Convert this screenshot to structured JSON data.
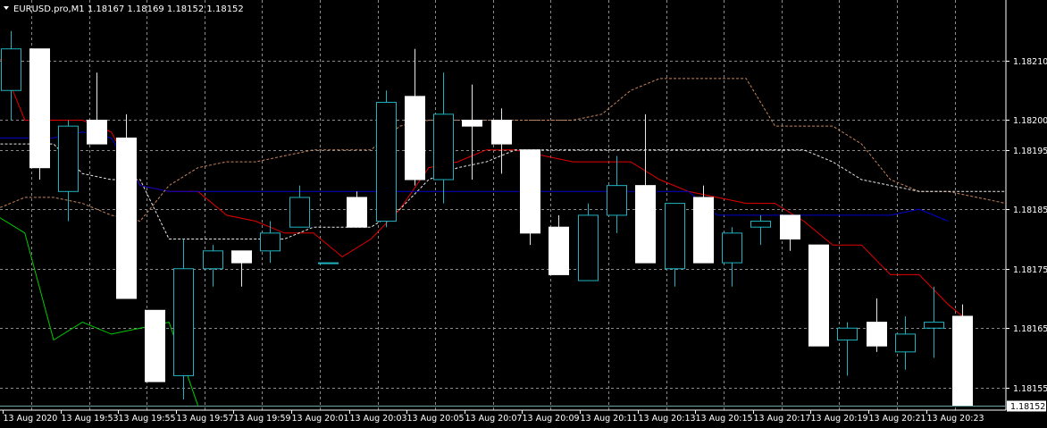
{
  "chart": {
    "title": "EURUSD.pro,M1  1.18167 1.18169 1.18152 1.18152",
    "current_price_label": "1.18152"
  },
  "chart_data": {
    "type": "candlestick",
    "symbol": "EURUSD.pro",
    "timeframe": "M1",
    "ylim": [
      1.18147,
      1.18218
    ],
    "y_ticks": [
      {
        "value": 1.1821,
        "label": "1.18210"
      },
      {
        "value": 1.182,
        "label": "1.18200"
      },
      {
        "value": 1.18195,
        "label": "1.18195"
      },
      {
        "value": 1.18185,
        "label": "1.18185"
      },
      {
        "value": 1.18175,
        "label": "1.18175"
      },
      {
        "value": 1.18165,
        "label": "1.18165"
      },
      {
        "value": 1.18155,
        "label": "1.18155"
      }
    ],
    "x_ticks": [
      {
        "index": 0,
        "label": "13 Aug 2020"
      },
      {
        "index": 2,
        "label": "13 Aug 19:53"
      },
      {
        "index": 4,
        "label": "13 Aug 19:55"
      },
      {
        "index": 6,
        "label": "13 Aug 19:57"
      },
      {
        "index": 8,
        "label": "13 Aug 19:59"
      },
      {
        "index": 10,
        "label": "13 Aug 20:01"
      },
      {
        "index": 12,
        "label": "13 Aug 20:03"
      },
      {
        "index": 14,
        "label": "13 Aug 20:05"
      },
      {
        "index": 16,
        "label": "13 Aug 20:07"
      },
      {
        "index": 18,
        "label": "13 Aug 20:09"
      },
      {
        "index": 20,
        "label": "13 Aug 20:11"
      },
      {
        "index": 22,
        "label": "13 Aug 20:13"
      },
      {
        "index": 24,
        "label": "13 Aug 20:15"
      },
      {
        "index": 26,
        "label": "13 Aug 20:17"
      },
      {
        "index": 28,
        "label": "13 Aug 20:19"
      },
      {
        "index": 30,
        "label": "13 Aug 20:21"
      },
      {
        "index": 32,
        "label": "13 Aug 20:23"
      }
    ],
    "current_price": 1.18152,
    "candles": [
      {
        "open": 1.18205,
        "high": 1.18215,
        "low": 1.182,
        "close": 1.18212
      },
      {
        "open": 1.18212,
        "high": 1.18212,
        "low": 1.1819,
        "close": 1.18192
      },
      {
        "open": 1.18188,
        "high": 1.182,
        "low": 1.18183,
        "close": 1.18199
      },
      {
        "open": 1.182,
        "high": 1.18208,
        "low": 1.18196,
        "close": 1.18196
      },
      {
        "open": 1.18197,
        "high": 1.18201,
        "low": 1.1817,
        "close": 1.1817
      },
      {
        "open": 1.18168,
        "high": 1.18168,
        "low": 1.18156,
        "close": 1.18156
      },
      {
        "open": 1.18157,
        "high": 1.1818,
        "low": 1.18153,
        "close": 1.18175
      },
      {
        "open": 1.18175,
        "high": 1.18179,
        "low": 1.18172,
        "close": 1.18178
      },
      {
        "open": 1.18178,
        "high": 1.18178,
        "low": 1.18172,
        "close": 1.18176
      },
      {
        "open": 1.18178,
        "high": 1.18183,
        "low": 1.18176,
        "close": 1.18181
      },
      {
        "open": 1.18182,
        "high": 1.18189,
        "low": 1.18182,
        "close": 1.18187
      },
      {
        "open": 1.18176,
        "high": 1.18176,
        "low": 1.18176,
        "close": 1.18176
      },
      {
        "open": 1.18187,
        "high": 1.18188,
        "low": 1.18182,
        "close": 1.18182
      },
      {
        "open": 1.18183,
        "high": 1.18205,
        "low": 1.18182,
        "close": 1.18203
      },
      {
        "open": 1.18204,
        "high": 1.18212,
        "low": 1.18189,
        "close": 1.1819
      },
      {
        "open": 1.1819,
        "high": 1.18208,
        "low": 1.18186,
        "close": 1.18201
      },
      {
        "open": 1.182,
        "high": 1.18206,
        "low": 1.1819,
        "close": 1.18199
      },
      {
        "open": 1.182,
        "high": 1.18202,
        "low": 1.18191,
        "close": 1.18196
      },
      {
        "open": 1.18195,
        "high": 1.18195,
        "low": 1.18179,
        "close": 1.18181
      },
      {
        "open": 1.18182,
        "high": 1.18184,
        "low": 1.18174,
        "close": 1.18174
      },
      {
        "open": 1.18173,
        "high": 1.18186,
        "low": 1.18173,
        "close": 1.18184
      },
      {
        "open": 1.18184,
        "high": 1.18194,
        "low": 1.18181,
        "close": 1.18189
      },
      {
        "open": 1.18189,
        "high": 1.18201,
        "low": 1.18176,
        "close": 1.18176
      },
      {
        "open": 1.18175,
        "high": 1.18186,
        "low": 1.18172,
        "close": 1.18186
      },
      {
        "open": 1.18187,
        "high": 1.18189,
        "low": 1.18176,
        "close": 1.18176
      },
      {
        "open": 1.18176,
        "high": 1.18182,
        "low": 1.18172,
        "close": 1.18181
      },
      {
        "open": 1.18182,
        "high": 1.18184,
        "low": 1.18179,
        "close": 1.18183
      },
      {
        "open": 1.18184,
        "high": 1.18184,
        "low": 1.18178,
        "close": 1.1818
      },
      {
        "open": 1.18179,
        "high": 1.18179,
        "low": 1.18162,
        "close": 1.18162
      },
      {
        "open": 1.18163,
        "high": 1.18166,
        "low": 1.18157,
        "close": 1.18165
      },
      {
        "open": 1.18166,
        "high": 1.1817,
        "low": 1.18161,
        "close": 1.18162
      },
      {
        "open": 1.18161,
        "high": 1.18167,
        "low": 1.18158,
        "close": 1.18164
      },
      {
        "open": 1.18165,
        "high": 1.18172,
        "low": 1.1816,
        "close": 1.18166
      },
      {
        "open": 1.18167,
        "high": 1.18169,
        "low": 1.18152,
        "close": 1.18152
      }
    ],
    "indicators": [
      {
        "kind": "tenkan",
        "color": "#e60000",
        "dash": "",
        "points": [
          [
            -0.5,
            1.18212
          ],
          [
            0.5,
            1.182
          ],
          [
            1.5,
            1.182
          ],
          [
            2.5,
            1.182
          ],
          [
            3.5,
            1.18198
          ],
          [
            4.5,
            1.18189
          ],
          [
            5.5,
            1.18188
          ],
          [
            6.5,
            1.18188
          ],
          [
            7.5,
            1.18184
          ],
          [
            8.5,
            1.18183
          ],
          [
            9.5,
            1.18181
          ],
          [
            10.5,
            1.18181
          ],
          [
            11.5,
            1.18177
          ],
          [
            12.5,
            1.1818
          ],
          [
            13.5,
            1.18185
          ],
          [
            14.5,
            1.18192
          ],
          [
            15.5,
            1.18193
          ],
          [
            16.5,
            1.18195
          ],
          [
            17.5,
            1.18195
          ],
          [
            18.5,
            1.18194
          ],
          [
            19.5,
            1.18193
          ],
          [
            20.5,
            1.18193
          ],
          [
            21.5,
            1.18193
          ],
          [
            22.5,
            1.1819
          ],
          [
            23.5,
            1.18188
          ],
          [
            24.5,
            1.18187
          ],
          [
            25.5,
            1.18186
          ],
          [
            26.5,
            1.18186
          ],
          [
            27.5,
            1.18183
          ],
          [
            28.5,
            1.18179
          ],
          [
            29.5,
            1.18179
          ],
          [
            30.5,
            1.18174
          ],
          [
            31.5,
            1.18174
          ],
          [
            32.5,
            1.18169
          ],
          [
            33,
            1.18167
          ]
        ]
      },
      {
        "kind": "kijun",
        "color": "#0000cc",
        "dash": "",
        "points": [
          [
            -0.5,
            1.18197
          ],
          [
            0.5,
            1.18197
          ],
          [
            1.5,
            1.18197
          ],
          [
            2.5,
            1.18198
          ],
          [
            3.5,
            1.18197
          ],
          [
            4.5,
            1.18189
          ],
          [
            5.5,
            1.18188
          ],
          [
            6.5,
            1.18188
          ],
          [
            7.5,
            1.18188
          ],
          [
            8.5,
            1.18188
          ],
          [
            9.5,
            1.18188
          ],
          [
            10.5,
            1.18188
          ],
          [
            11.5,
            1.18188
          ],
          [
            12.5,
            1.18188
          ],
          [
            13.5,
            1.18188
          ],
          [
            14.5,
            1.18188
          ],
          [
            15.5,
            1.18188
          ],
          [
            16.5,
            1.18188
          ],
          [
            17.5,
            1.18188
          ],
          [
            18.5,
            1.18188
          ],
          [
            19.5,
            1.18188
          ],
          [
            20.5,
            1.18188
          ],
          [
            21.5,
            1.18188
          ],
          [
            22.5,
            1.18188
          ],
          [
            23.5,
            1.18188
          ],
          [
            24.5,
            1.18184
          ],
          [
            25.5,
            1.18184
          ],
          [
            26.5,
            1.18184
          ],
          [
            27.5,
            1.18184
          ],
          [
            28.5,
            1.18184
          ],
          [
            29.5,
            1.18184
          ],
          [
            30.5,
            1.18184
          ],
          [
            31.5,
            1.18185
          ],
          [
            32.5,
            1.18183
          ]
        ]
      },
      {
        "kind": "chikou",
        "color": "#00cc00",
        "dash": "",
        "points": [
          [
            -0.5,
            1.18184
          ],
          [
            0.5,
            1.18181
          ],
          [
            1.5,
            1.18163
          ],
          [
            2.5,
            1.18166
          ],
          [
            3.5,
            1.18164
          ],
          [
            4.5,
            1.18165
          ],
          [
            5.5,
            1.18166
          ],
          [
            6.5,
            1.18152
          ]
        ]
      },
      {
        "kind": "senkou-a",
        "color": "#c8855a",
        "dash": "3,2",
        "points": [
          [
            -0.5,
            1.18185
          ],
          [
            0.5,
            1.18187
          ],
          [
            1.5,
            1.18187
          ],
          [
            2.5,
            1.18186
          ],
          [
            3.5,
            1.18184
          ],
          [
            4.5,
            1.18183
          ],
          [
            5.5,
            1.18189
          ],
          [
            6.5,
            1.18192
          ],
          [
            7.5,
            1.18193
          ],
          [
            8.5,
            1.18193
          ],
          [
            9.5,
            1.18194
          ],
          [
            10.5,
            1.18195
          ],
          [
            11.5,
            1.18195
          ],
          [
            12.5,
            1.18195
          ],
          [
            13.5,
            1.18199
          ],
          [
            14.5,
            1.182
          ],
          [
            15.5,
            1.182
          ],
          [
            16.5,
            1.182
          ],
          [
            17.5,
            1.182
          ],
          [
            18.5,
            1.182
          ],
          [
            19.5,
            1.182
          ],
          [
            20.5,
            1.18201
          ],
          [
            21.5,
            1.18205
          ],
          [
            22.5,
            1.18207
          ],
          [
            23.5,
            1.18207
          ],
          [
            24.5,
            1.18207
          ],
          [
            25.5,
            1.18207
          ],
          [
            26.5,
            1.18199
          ],
          [
            27.5,
            1.18199
          ],
          [
            28.5,
            1.18199
          ],
          [
            29.5,
            1.18196
          ],
          [
            30.5,
            1.1819
          ],
          [
            31.5,
            1.18188
          ],
          [
            32.5,
            1.18188
          ],
          [
            33.5,
            1.18187
          ],
          [
            34.5,
            1.18186
          ]
        ]
      },
      {
        "kind": "senkou-b",
        "color": "#e8e8e8",
        "dash": "3,2",
        "points": [
          [
            -0.5,
            1.18196
          ],
          [
            0.5,
            1.18196
          ],
          [
            1.5,
            1.18196
          ],
          [
            2.5,
            1.18191
          ],
          [
            3.5,
            1.1819
          ],
          [
            4.5,
            1.1819
          ],
          [
            5.5,
            1.1818
          ],
          [
            6.5,
            1.1818
          ],
          [
            7.5,
            1.1818
          ],
          [
            8.5,
            1.1818
          ],
          [
            9.5,
            1.1818
          ],
          [
            10.5,
            1.18182
          ],
          [
            11.5,
            1.18182
          ],
          [
            12.5,
            1.18182
          ],
          [
            13.5,
            1.18185
          ],
          [
            14.5,
            1.1819
          ],
          [
            15.5,
            1.18192
          ],
          [
            16.5,
            1.18193
          ],
          [
            17.5,
            1.18195
          ],
          [
            18.5,
            1.18195
          ],
          [
            19.5,
            1.18195
          ],
          [
            20.5,
            1.18195
          ],
          [
            21.5,
            1.18195
          ],
          [
            22.5,
            1.18195
          ],
          [
            23.5,
            1.18195
          ],
          [
            24.5,
            1.18195
          ],
          [
            25.5,
            1.18195
          ],
          [
            26.5,
            1.18195
          ],
          [
            27.5,
            1.18195
          ],
          [
            28.5,
            1.18193
          ],
          [
            29.5,
            1.1819
          ],
          [
            30.5,
            1.18189
          ],
          [
            31.5,
            1.18188
          ],
          [
            32.5,
            1.18188
          ],
          [
            33.5,
            1.18188
          ],
          [
            34.5,
            1.18188
          ]
        ]
      }
    ]
  }
}
